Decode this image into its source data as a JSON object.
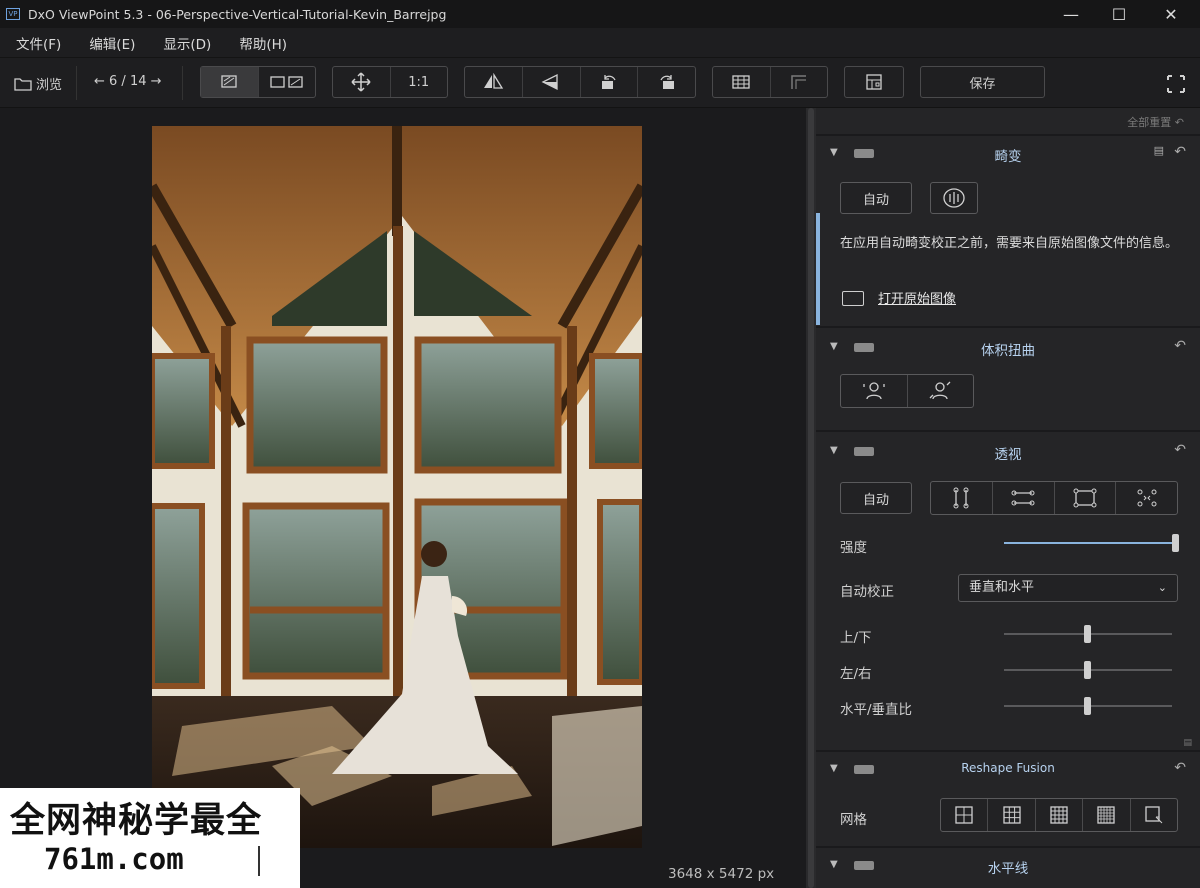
{
  "window": {
    "title": "DxO ViewPoint 5.3 - 06-Perspective-Vertical-Tutorial-Kevin_Barrejpg",
    "minimize": "—",
    "maximize": "☐",
    "close": "✕"
  },
  "menu": [
    "文件(F)",
    "编辑(E)",
    "显示(D)",
    "帮助(H)"
  ],
  "toolbar": {
    "browse": "浏览",
    "nav": "← 6 / 14 →",
    "zoom_1to1": "1:1",
    "save": "保存"
  },
  "canvas": {
    "dimensions": "3648 x 5472 px"
  },
  "watermark": {
    "line1": "全网神秘学最全",
    "line2": "761m.com"
  },
  "panel": {
    "reset_all": "全部重置",
    "sections": {
      "distortion": {
        "title": "畸变",
        "auto": "自动",
        "info": "在应用自动畸变校正之前，需要来自原始图像文件的信息。",
        "open_link": "打开原始图像"
      },
      "volume": {
        "title": "体积扭曲"
      },
      "perspective": {
        "title": "透视",
        "auto": "自动",
        "strength_label": "强度",
        "strength_value": 1.0,
        "auto_correct_label": "自动校正",
        "auto_correct_value": "垂直和水平",
        "vertical_label": "上/下",
        "vertical_value": 0.5,
        "horizontal_label": "左/右",
        "horizontal_value": 0.5,
        "ratio_label": "水平/垂直比",
        "ratio_value": 0.5
      },
      "reshape": {
        "title": "Reshape Fusion",
        "grid_label": "网格"
      },
      "horizon": {
        "title": "水平线"
      }
    }
  }
}
